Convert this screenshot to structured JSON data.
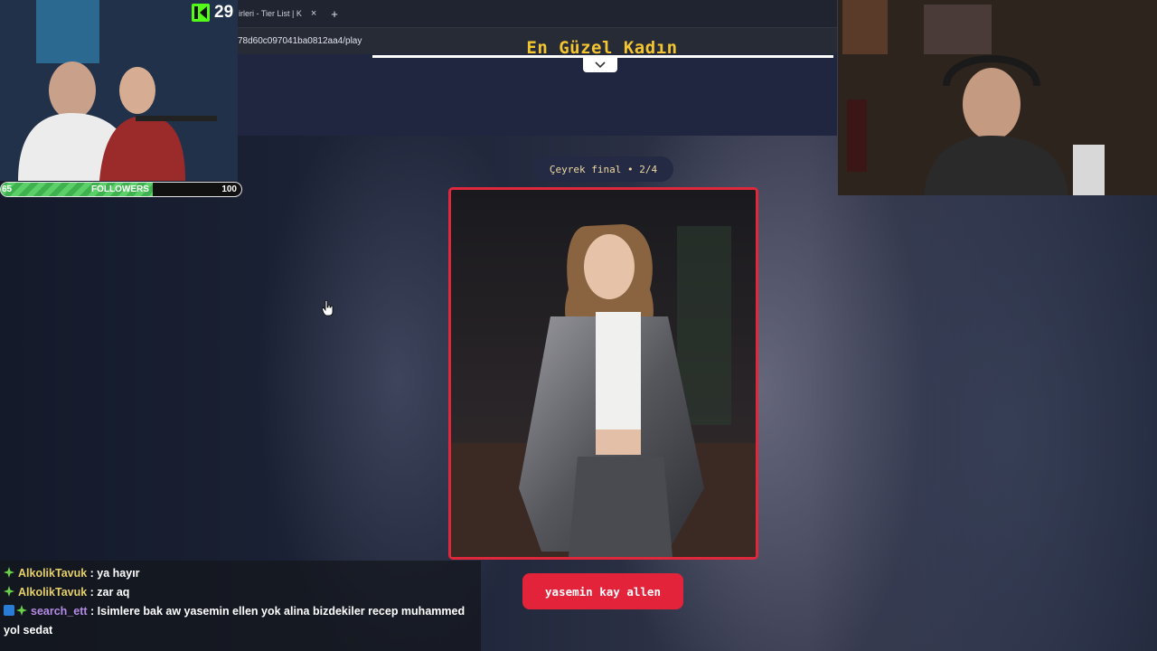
{
  "browser": {
    "tab_title": "irleri - Tier List | K",
    "tab_close": "×",
    "new_tab": "+",
    "url": "78d60c097041ba0812aa4/play"
  },
  "site": {
    "collapse_icon": "chevron-down-icon",
    "title": "En Güzel Kadın",
    "round_label": "Çeyrek final • 2/4",
    "contestant_name": "yasemin kay allen"
  },
  "stream": {
    "kick_count": "29",
    "followers": {
      "current": "65",
      "label": "FOLLOWERS",
      "goal": "100",
      "progress": 0.63
    }
  },
  "chat": {
    "messages": [
      {
        "user": "AlkolikTavuk",
        "separator": " : ",
        "text": "ya hayır"
      },
      {
        "user": "AlkolikTavuk",
        "separator": " : ",
        "text": "zar aq"
      },
      {
        "user": "search_ett",
        "separator": " : ",
        "text": "Isimlere bak aw yasemin ellen yok alina bizdekiler recep muhammed yol sedat"
      }
    ]
  },
  "colors": {
    "accent_yellow": "#f4c531",
    "accent_red": "#e2233a",
    "kick_green": "#53fc18"
  }
}
